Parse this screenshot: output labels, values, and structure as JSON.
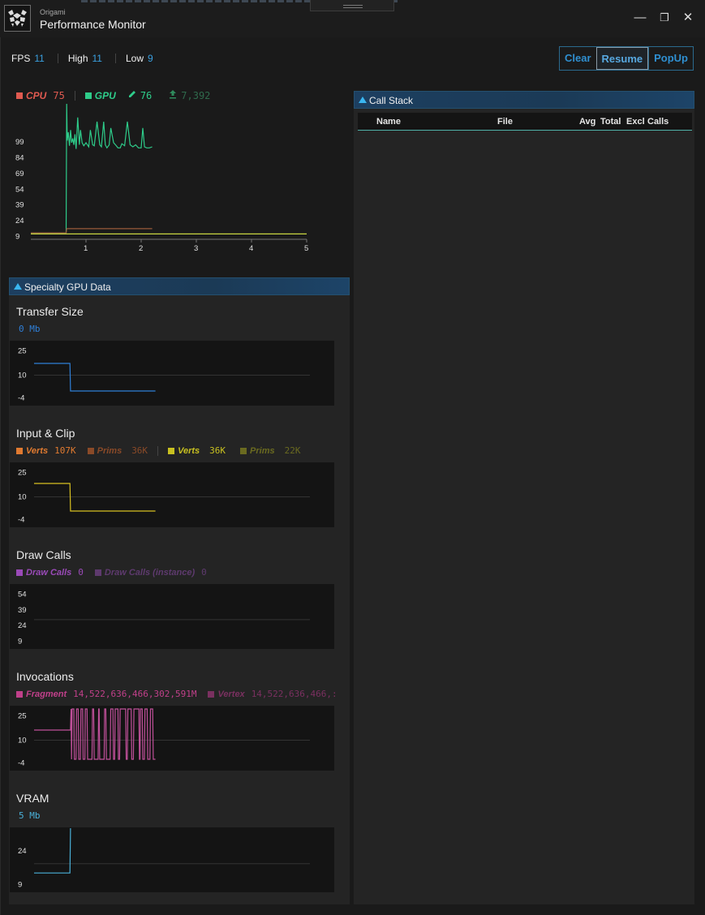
{
  "window": {
    "app_name": "Origami",
    "title": "Performance Monitor",
    "minimize_glyph": "—",
    "restore_glyph": "❐",
    "close_glyph": "✕"
  },
  "stats": {
    "fps_label": "FPS",
    "fps_value": "11",
    "high_label": "High",
    "high_value": "11",
    "low_label": "Low",
    "low_value": "9"
  },
  "toolbar": {
    "clear": "Clear",
    "resume": "Resume",
    "popup": "PopUp",
    "active": "Resume"
  },
  "main_chart": {
    "legend": {
      "cpu_label": "CPU",
      "cpu_value": "75",
      "gpu_label": "GPU",
      "gpu_value": "76",
      "memory_value": "7,392"
    },
    "colors": {
      "cpu": "#e05a50",
      "gpu": "#2ecc8a",
      "mem": "#2f8a5c",
      "fps": "#c8d640",
      "cpu_line": "#9a5a3a"
    }
  },
  "chart_data": [
    {
      "type": "line",
      "title": "",
      "y_ticks": [
        "99",
        "84",
        "69",
        "54",
        "39",
        "24",
        "9"
      ],
      "x_ticks": [
        "1",
        "2",
        "3",
        "4",
        "5"
      ],
      "xlim": [
        0,
        5
      ],
      "ylim": [
        9,
        135
      ],
      "series": [
        {
          "name": "GPU",
          "color": "#2ecc8a",
          "x": [
            0,
            0.64,
            0.65,
            0.66,
            0.68,
            0.7,
            0.72,
            0.74,
            0.76,
            0.78,
            0.8,
            0.82,
            0.85,
            0.88,
            0.9,
            0.93,
            0.96,
            1.0,
            1.05,
            1.08,
            1.12,
            1.15,
            1.2,
            1.25,
            1.28,
            1.32,
            1.35,
            1.38,
            1.42,
            1.45,
            1.5,
            1.55,
            1.58,
            1.62,
            1.65,
            1.7,
            1.75,
            1.8,
            1.85,
            1.9,
            1.95,
            2.0,
            2.03,
            2.06,
            2.1,
            2.15,
            2.2
          ],
          "y": [
            12,
            12,
            135,
            100,
            108,
            95,
            110,
            98,
            102,
            96,
            106,
            92,
            122,
            96,
            110,
            98,
            95,
            98,
            94,
            110,
            96,
            95,
            118,
            96,
            94,
            118,
            96,
            93,
            96,
            112,
            98,
            95,
            93,
            93,
            97,
            95,
            118,
            96,
            94,
            96,
            93,
            93,
            112,
            94,
            93,
            93,
            94
          ]
        },
        {
          "name": "CPU",
          "color": "#9a5a3a",
          "x": [
            0,
            0.64,
            0.65,
            2.2
          ],
          "y": [
            12,
            12,
            16,
            16
          ]
        },
        {
          "name": "FPS",
          "color": "#c8d640",
          "x": [
            0,
            5
          ],
          "y": [
            11,
            11
          ]
        }
      ]
    },
    {
      "type": "line",
      "title": "Transfer Size",
      "y_ticks": [
        "25",
        "10",
        "-4"
      ],
      "ylim": [
        -4,
        25
      ],
      "xlim": [
        0,
        5
      ],
      "series": [
        {
          "name": "Transfer Size",
          "color": "#2f7fd8",
          "x": [
            0,
            0.65,
            0.66,
            2.2
          ],
          "y": [
            17,
            17,
            0,
            0
          ]
        }
      ]
    },
    {
      "type": "line",
      "title": "Input & Clip",
      "y_ticks": [
        "25",
        "10",
        "-4"
      ],
      "ylim": [
        -4,
        25
      ],
      "xlim": [
        0,
        5
      ],
      "series": [
        {
          "name": "Verts",
          "color": "#d8c020",
          "x": [
            0,
            0.65,
            0.66,
            2.2
          ],
          "y": [
            18,
            18,
            1,
            1
          ]
        }
      ]
    },
    {
      "type": "line",
      "title": "Draw Calls",
      "y_ticks": [
        "54",
        "39",
        "24",
        "9"
      ],
      "ylim": [
        9,
        54
      ],
      "xlim": [
        0,
        5
      ],
      "series": []
    },
    {
      "type": "line",
      "title": "Invocations",
      "y_ticks": [
        "25",
        "10",
        "-4"
      ],
      "ylim": [
        -4,
        25
      ],
      "xlim": [
        0,
        5
      ],
      "series": [
        {
          "name": "Fragment",
          "color": "#c0509a",
          "x": [
            0,
            0.66,
            0.67,
            0.68,
            0.69,
            0.72,
            0.73,
            0.76,
            0.77,
            0.8,
            0.81,
            0.84,
            0.85,
            0.88,
            0.89,
            0.92,
            0.93,
            0.96,
            0.97,
            1.05,
            1.06,
            1.08,
            1.09,
            1.16,
            1.17,
            1.18,
            1.19,
            1.27,
            1.28,
            1.3,
            1.31,
            1.38,
            1.39,
            1.43,
            1.44,
            1.46,
            1.47,
            1.52,
            1.53,
            1.55,
            1.56,
            1.66,
            1.67,
            1.69,
            1.7,
            1.76,
            1.77,
            1.8,
            1.81,
            1.9,
            1.91,
            1.92,
            1.93,
            1.96,
            1.97,
            2.0,
            2.01,
            2.05,
            2.06,
            2.1,
            2.11,
            2.15,
            2.16,
            2.2
          ],
          "y": [
            16,
            16,
            29,
            -2,
            29,
            29,
            -2,
            -2,
            29,
            29,
            -2,
            -2,
            29,
            29,
            -2,
            -2,
            29,
            29,
            -2,
            -2,
            29,
            29,
            -2,
            -2,
            29,
            29,
            -2,
            -2,
            29,
            29,
            -2,
            -2,
            29,
            29,
            -2,
            -2,
            29,
            29,
            -2,
            -2,
            29,
            29,
            -2,
            -2,
            29,
            29,
            -2,
            -2,
            29,
            29,
            -2,
            -2,
            29,
            29,
            -2,
            -2,
            29,
            29,
            -2,
            -2,
            29,
            29,
            -2,
            -2
          ]
        }
      ]
    },
    {
      "type": "line",
      "title": "VRAM",
      "y_ticks": [
        "24",
        "9"
      ],
      "ylim": [
        9,
        30
      ],
      "xlim": [
        0,
        5
      ],
      "series": [
        {
          "name": "VRAM",
          "color": "#4ab0d8",
          "x": [
            0,
            0.65,
            0.66
          ],
          "y": [
            14,
            14,
            34
          ]
        }
      ]
    }
  ],
  "specialty": {
    "header": "Specialty GPU Data",
    "transfer": {
      "title": "Transfer Size",
      "value": "0 Mb",
      "color": "#2f7fd8"
    },
    "input": {
      "title": "Input & Clip",
      "verts1_label": "Verts",
      "verts1_value": "107K",
      "prims1_label": "Prims",
      "prims1_value": "36K",
      "verts2_label": "Verts",
      "verts2_value": "36K",
      "prims2_label": "Prims",
      "prims2_value": "22K"
    },
    "draw": {
      "title": "Draw Calls",
      "calls_label": "Draw Calls",
      "calls_value": "0",
      "instance_label": "Draw Calls (instance)",
      "instance_value": "0"
    },
    "invocations": {
      "title": "Invocations",
      "fragment_label": "Fragment",
      "fragment_value": "14,522,636,466,302,591M",
      "vertex_label": "Vertex",
      "vertex_value": "14,522,636,466,:"
    },
    "vram": {
      "title": "VRAM",
      "value": "5 Mb"
    }
  },
  "callstack": {
    "header": "Call Stack",
    "columns": {
      "name": "Name",
      "file": "File",
      "avg": "Avg",
      "total": "Total",
      "excl": "Excl",
      "calls": "Calls"
    }
  }
}
